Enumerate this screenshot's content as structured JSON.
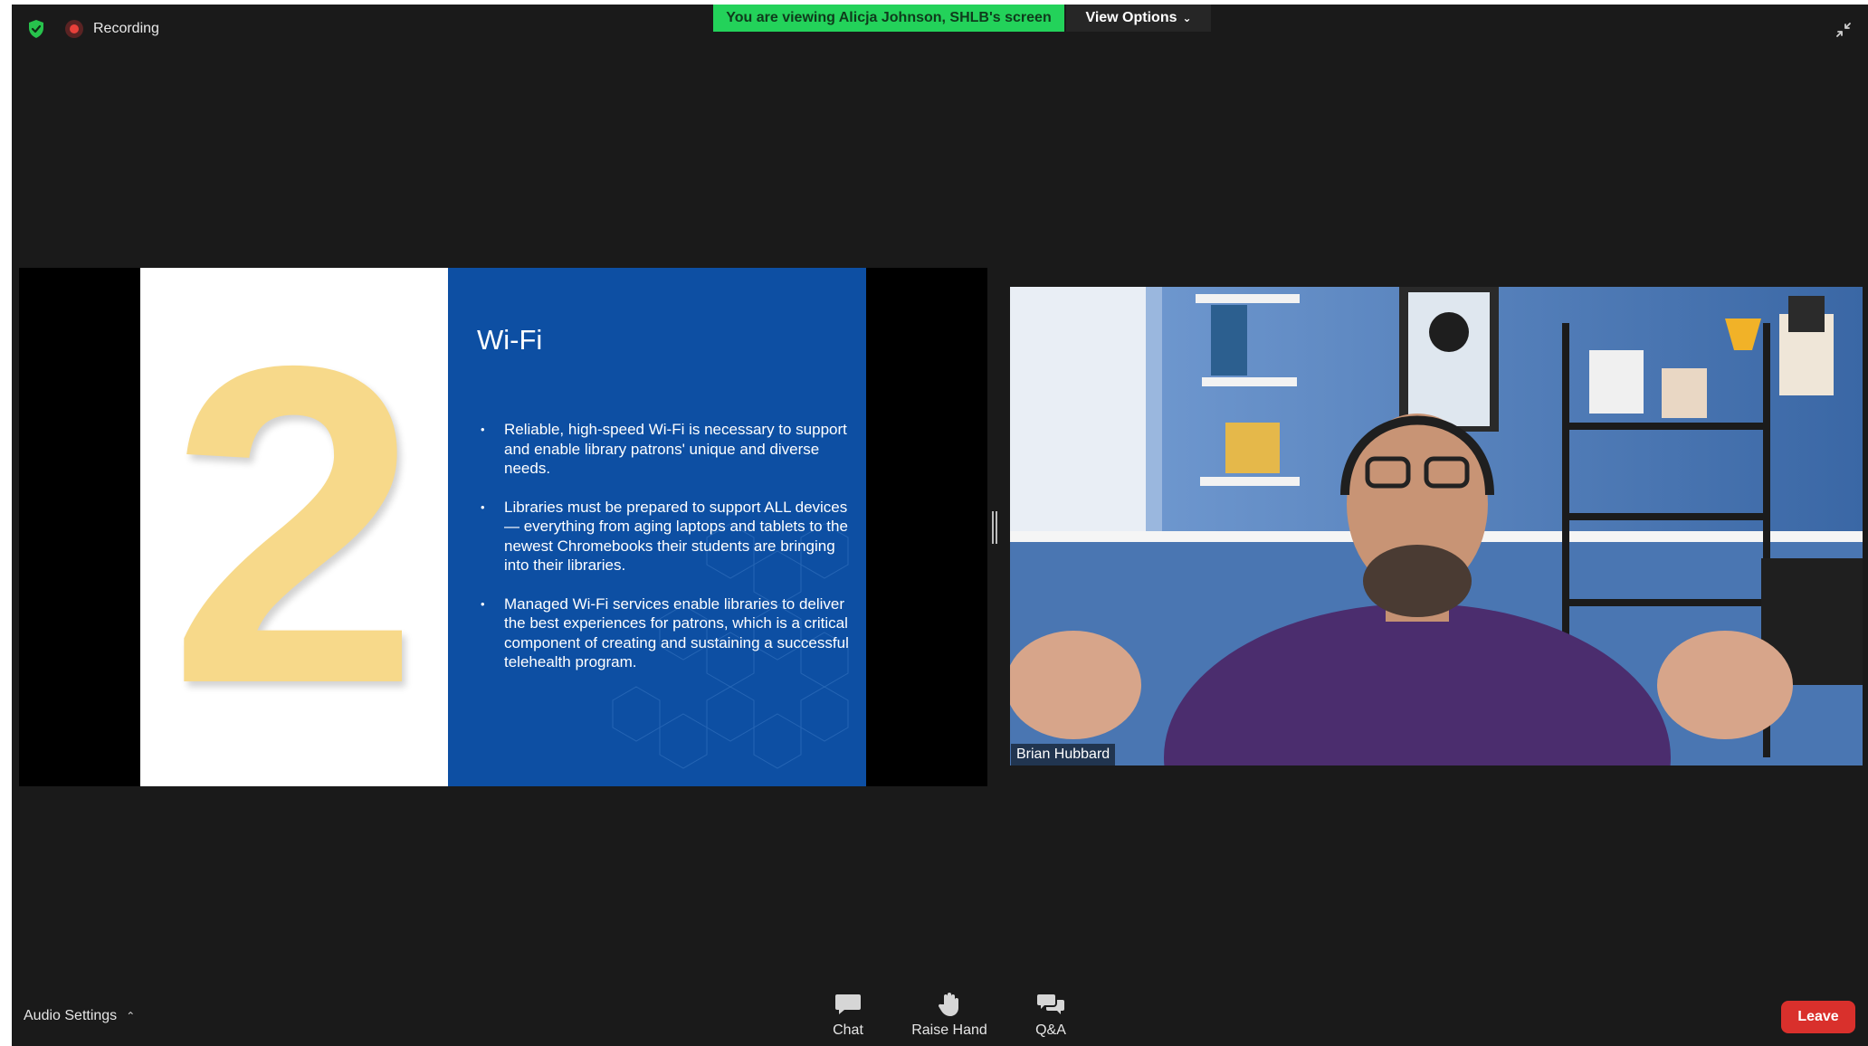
{
  "status": {
    "recording_label": "Recording"
  },
  "banner": {
    "viewing_text": "You are viewing Alicja Johnson, SHLB's screen",
    "view_options_label": "View Options"
  },
  "slide": {
    "number": "2",
    "title": "Wi-Fi",
    "bullets": [
      "Reliable, high-speed Wi-Fi is necessary to support and enable library patrons' unique and diverse needs.",
      "Libraries must be prepared to support ALL devices — everything from aging laptops and tablets to the newest Chromebooks their students are bringing into their libraries.",
      "Managed Wi-Fi services enable libraries to deliver the best experiences for patrons, which is a critical component of creating and sustaining a successful telehealth program."
    ]
  },
  "video": {
    "participant_name": "Brian Hubbard"
  },
  "toolbar": {
    "audio_settings_label": "Audio Settings",
    "chat_label": "Chat",
    "raise_hand_label": "Raise Hand",
    "qa_label": "Q&A",
    "leave_label": "Leave"
  },
  "colors": {
    "banner_green": "#23d25a",
    "slide_blue": "#0d4fa3",
    "slide_number_yellow": "#f7d98a",
    "leave_red": "#d9302c",
    "shield_green": "#27c24c",
    "recording_red": "#e8403a"
  },
  "icons": {
    "shield": "shield-check-icon",
    "recording": "recording-dot-icon",
    "collapse": "collapse-icon",
    "chat": "chat-bubble-icon",
    "raise_hand": "hand-icon",
    "qa": "qa-bubbles-icon"
  }
}
